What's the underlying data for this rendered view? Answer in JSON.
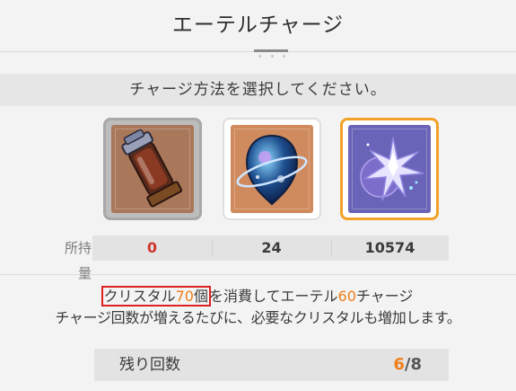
{
  "header": {
    "title": "エーテルチャージ"
  },
  "prompt": "チャージ方法を選択してください。",
  "items": [
    {
      "name": "ether-potion-icon",
      "held": "0",
      "held_color": "#d0342c",
      "selected": false
    },
    {
      "name": "ether-orb-icon",
      "held": "24",
      "held_color": "#3a3a3a",
      "selected": false
    },
    {
      "name": "crystal-icon",
      "held": "10574",
      "held_color": "#3a3a3a",
      "selected": true
    }
  ],
  "held_label": "所持量",
  "description": {
    "crystal_word": "クリスタル",
    "crystal_amount": "70",
    "crystal_unit": "個",
    "mid_text": "を消費してエーテル",
    "ether_amount": "60",
    "end_text": "チャージ",
    "note": "チャージ回数が増えるたびに、必要なクリスタルも増加します。"
  },
  "remaining": {
    "label": "残り回数",
    "current": "6",
    "separator": "/",
    "total": "8"
  },
  "colors": {
    "accent_orange": "#ef7f1a",
    "selected_border": "#f2a227",
    "zero_red": "#d0342c",
    "highlight_box": "#e02020"
  }
}
